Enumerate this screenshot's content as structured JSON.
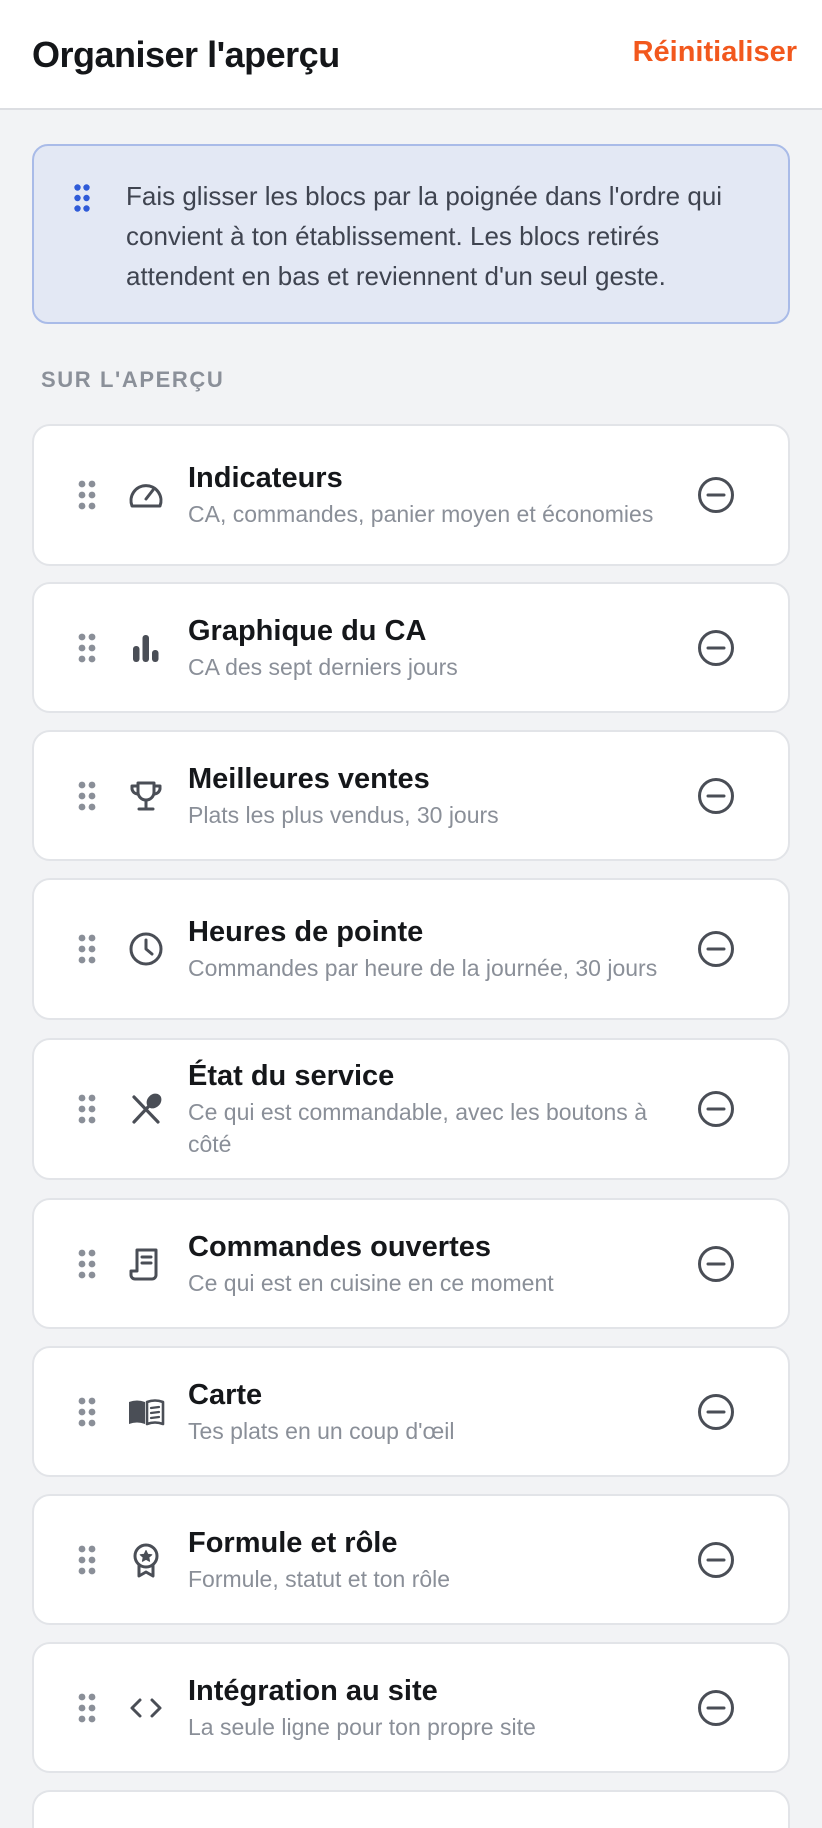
{
  "header": {
    "title": "Organiser l'aperçu",
    "reset_label": "Réinitialiser"
  },
  "info": {
    "text": "Fais glisser les blocs par la poignée dans l'ordre qui convient à ton établissement. Les blocs retirés attendent en bas et reviennent d'un seul geste."
  },
  "section": {
    "label": "SUR L'APERÇU"
  },
  "blocks": [
    {
      "title": "Indicateurs",
      "subtitle": "CA, commandes, panier moyen et économies",
      "icon": "gauge-icon"
    },
    {
      "title": "Graphique du CA",
      "subtitle": "CA des sept derniers jours",
      "icon": "bar-chart-icon"
    },
    {
      "title": "Meilleures ventes",
      "subtitle": "Plats les plus vendus, 30 jours",
      "icon": "trophy-icon"
    },
    {
      "title": "Heures de pointe",
      "subtitle": "Commandes par heure de la journée, 30 jours",
      "icon": "clock-icon"
    },
    {
      "title": "État du service",
      "subtitle": "Ce qui est commandable, avec les boutons à côté",
      "icon": "utensils-icon"
    },
    {
      "title": "Commandes ouvertes",
      "subtitle": "Ce qui est en cuisine en ce moment",
      "icon": "receipt-icon"
    },
    {
      "title": "Carte",
      "subtitle": "Tes plats en un coup d'œil",
      "icon": "menu-book-icon"
    },
    {
      "title": "Formule et rôle",
      "subtitle": "Formule, statut et ton rôle",
      "icon": "badge-icon"
    },
    {
      "title": "Intégration au site",
      "subtitle": "La seule ligne pour ton propre site",
      "icon": "code-icon"
    }
  ],
  "colors": {
    "accent": "#f2581d",
    "info_bg": "#e3e8f4",
    "info_border": "#a9bbe8",
    "grip_blue": "#2f5bd8",
    "icon_gray": "#4a4e56",
    "handle_gray": "#8a8f98"
  }
}
